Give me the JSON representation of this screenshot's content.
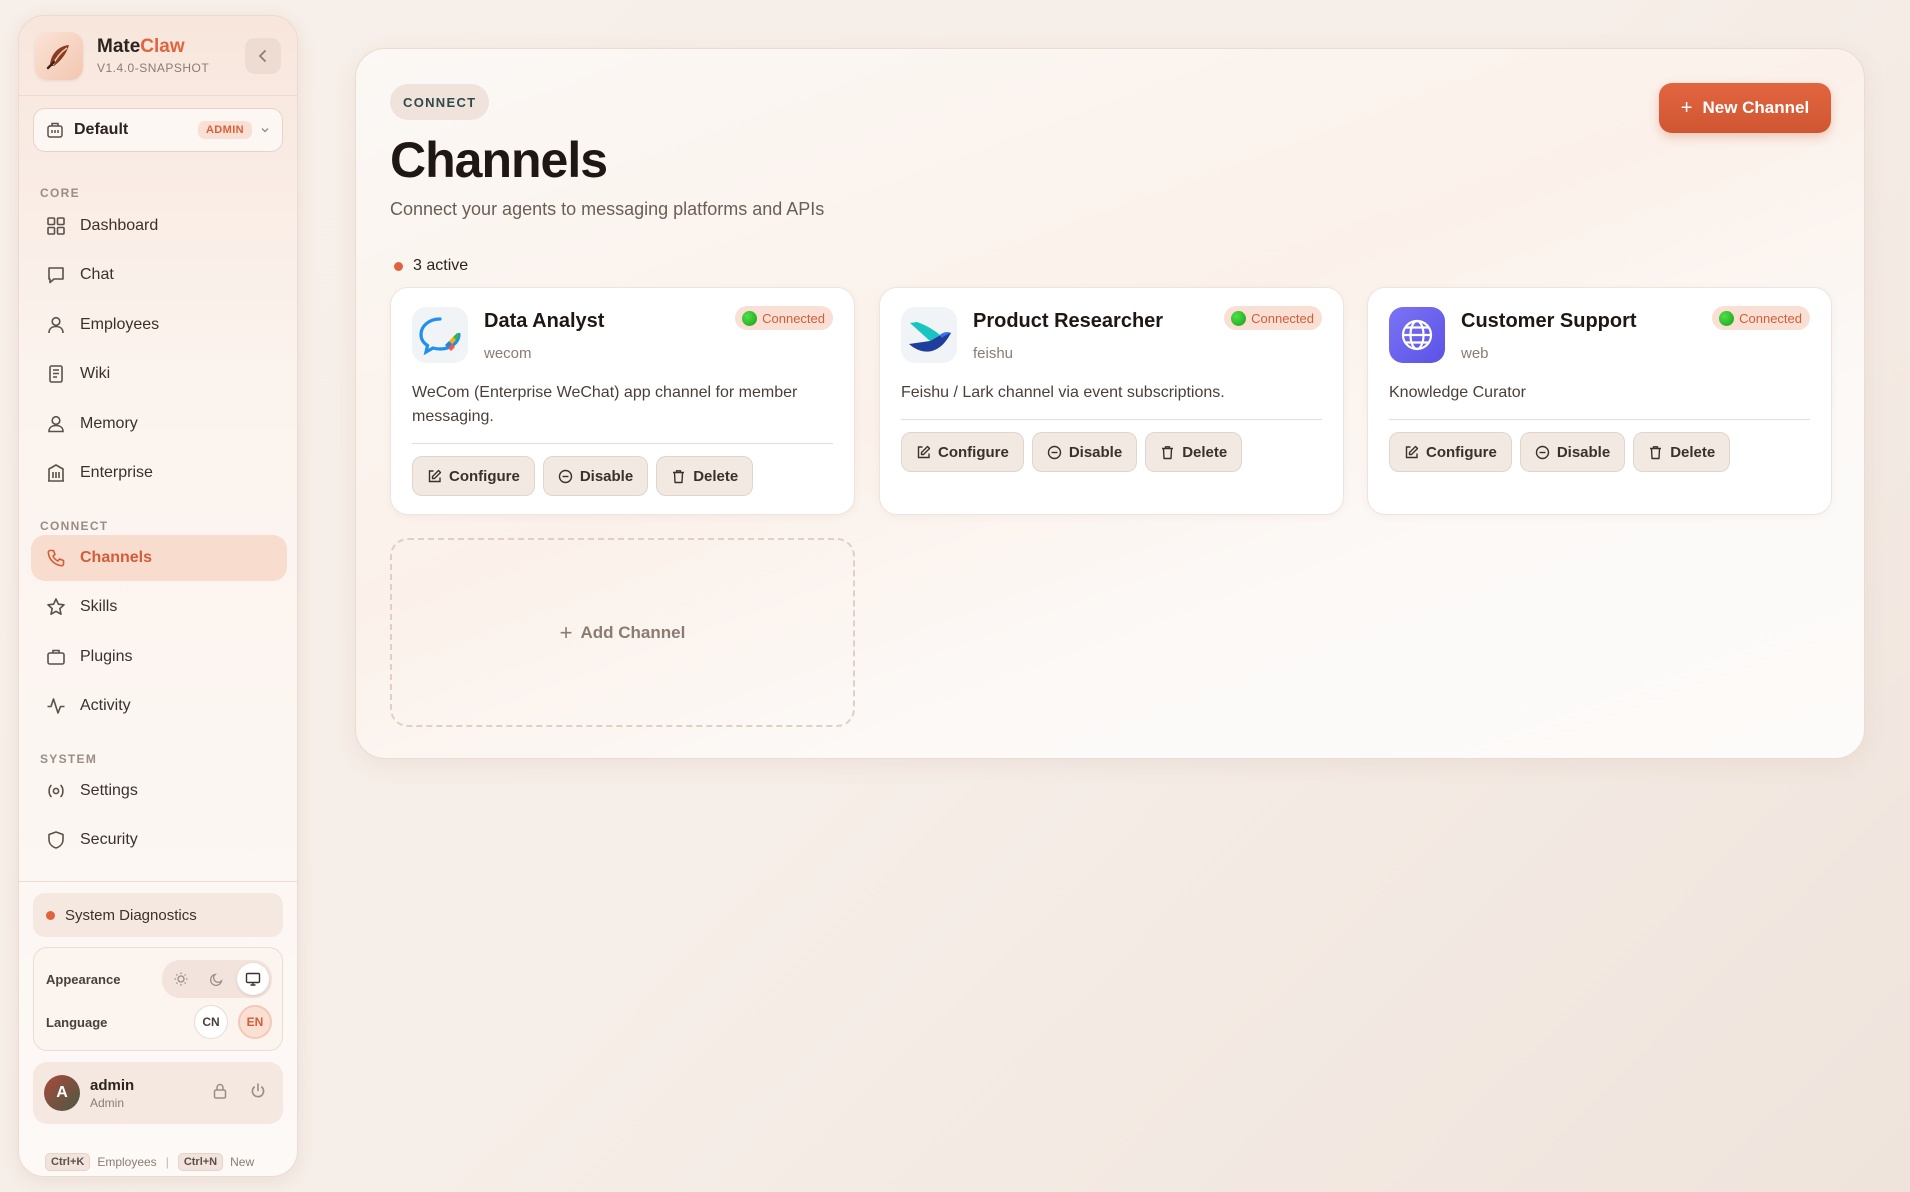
{
  "brand": {
    "name_main": "Mate",
    "name_accent": "Claw",
    "version": "V1.4.0-SNAPSHOT"
  },
  "workspace": {
    "name": "Default",
    "badge": "ADMIN"
  },
  "sidebar": {
    "sections": {
      "core": "CORE",
      "connect": "CONNECT",
      "system": "SYSTEM"
    },
    "items": [
      {
        "label": "Dashboard",
        "icon": "grid-icon"
      },
      {
        "label": "Chat",
        "icon": "chat-icon"
      },
      {
        "label": "Employees",
        "icon": "person-icon"
      },
      {
        "label": "Wiki",
        "icon": "book-icon"
      },
      {
        "label": "Memory",
        "icon": "user-memory-icon"
      },
      {
        "label": "Enterprise",
        "icon": "building-icon"
      },
      {
        "label": "Channels",
        "icon": "phone-icon",
        "active": true
      },
      {
        "label": "Skills",
        "icon": "star-icon"
      },
      {
        "label": "Plugins",
        "icon": "briefcase-icon"
      },
      {
        "label": "Activity",
        "icon": "activity-icon"
      },
      {
        "label": "Settings",
        "icon": "settings-icon"
      },
      {
        "label": "Security",
        "icon": "shield-icon"
      }
    ],
    "diagnostics": "System Diagnostics",
    "appearance_label": "Appearance",
    "appearance_selected": "system",
    "language_label": "Language",
    "languages": [
      "CN",
      "EN"
    ],
    "language_selected": "EN",
    "user": {
      "initial": "A",
      "name": "admin",
      "role": "Admin"
    },
    "shortcuts": [
      {
        "key": "Ctrl+K",
        "label": "Employees"
      },
      {
        "key": "Ctrl+N",
        "label": "New"
      }
    ]
  },
  "page": {
    "pill": "CONNECT",
    "title": "Channels",
    "subtitle": "Connect your agents to messaging platforms and APIs",
    "new_button": "New Channel",
    "active_count": "3 active",
    "add_channel": "Add Channel"
  },
  "channels": [
    {
      "name": "Data Analyst",
      "type": "wecom",
      "status": "Connected",
      "description": "WeCom (Enterprise WeChat) app channel for member messaging.",
      "icon": "wecom-icon"
    },
    {
      "name": "Product Researcher",
      "type": "feishu",
      "status": "Connected",
      "description": "Feishu / Lark channel via event subscriptions.",
      "icon": "feishu-icon"
    },
    {
      "name": "Customer Support",
      "type": "web",
      "status": "Connected",
      "description": "Knowledge Curator",
      "icon": "globe-icon"
    }
  ],
  "card_actions": {
    "configure": "Configure",
    "disable": "Disable",
    "delete": "Delete"
  },
  "colors": {
    "accent": "#e0653f",
    "active_nav_bg": "#f8dccd",
    "status_green": "#22b31c"
  }
}
